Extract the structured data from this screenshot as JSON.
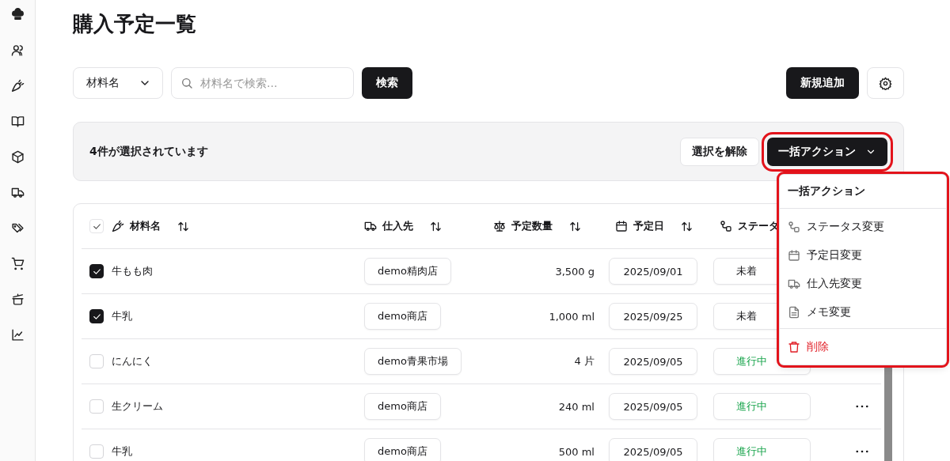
{
  "page": {
    "title": "購入予定一覧"
  },
  "toolbar": {
    "filter_select": {
      "value": "材料名"
    },
    "search": {
      "placeholder": "材料名で検索..."
    },
    "search_button": "検索",
    "add_button": "新規追加"
  },
  "selection_bar": {
    "message": "4件が選択されています",
    "clear_button": "選択を解除",
    "bulk_button": {
      "label": "一括アクション",
      "highlighted": true
    }
  },
  "bulk_menu": {
    "title": "一括アクション",
    "highlighted": true,
    "items": [
      {
        "label": "ステータス変更",
        "kind": "action"
      },
      {
        "label": "予定日変更",
        "kind": "action"
      },
      {
        "label": "仕入先変更",
        "kind": "action"
      },
      {
        "label": "メモ変更",
        "kind": "action"
      },
      {
        "label": "削除",
        "kind": "danger"
      }
    ]
  },
  "table": {
    "select_all": {
      "checked": true
    },
    "columns": [
      {
        "label": "材料名"
      },
      {
        "label": "仕入先"
      },
      {
        "label": "予定数量"
      },
      {
        "label": "予定日"
      },
      {
        "label": "ステータ"
      }
    ],
    "rows": [
      {
        "checked": true,
        "name": "牛もも肉",
        "supplier": "demo精肉店",
        "quantity": "3,500 g",
        "date": "2025/09/01",
        "status": "未着",
        "color": "#18181b",
        "menu_button": false
      },
      {
        "checked": true,
        "name": "牛乳",
        "supplier": "demo商店",
        "quantity": "1,000 ml",
        "date": "2025/09/25",
        "status": "未着",
        "color": "#18181b",
        "menu_button": false
      },
      {
        "checked": false,
        "name": "にんにく",
        "supplier": "demo青果市場",
        "quantity": "4 片",
        "date": "2025/09/05",
        "status": "進行中",
        "color": "#16a34a",
        "menu_button": false
      },
      {
        "checked": false,
        "name": "生クリーム",
        "supplier": "demo商店",
        "quantity": "240 ml",
        "date": "2025/09/05",
        "status": "進行中",
        "color": "#16a34a",
        "menu_button": true
      },
      {
        "checked": false,
        "name": "牛乳",
        "supplier": "demo商店",
        "quantity": "500 ml",
        "date": "2025/09/05",
        "status": "進行中",
        "color": "#16a34a",
        "menu_button": true
      }
    ]
  }
}
